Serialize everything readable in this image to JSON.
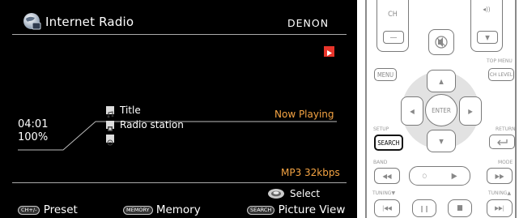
{
  "screen": {
    "title": "Internet Radio",
    "brand": "DENON",
    "status": "Now Playing",
    "time": "04:01",
    "buffer": "100%",
    "meta": [
      {
        "icon": "music-note-icon",
        "text": "Title"
      },
      {
        "icon": "radio-station-icon",
        "text": "Radio station"
      },
      {
        "icon": "album-icon",
        "text": ""
      }
    ],
    "format": "MP3 32kbps",
    "select_label": "Select",
    "footer": [
      {
        "key": "CH+/-",
        "label": "Preset"
      },
      {
        "key": "MEMORY",
        "label": "Memory"
      },
      {
        "key": "SEARCH",
        "label": "Picture View"
      }
    ],
    "colors": {
      "background": "#000000",
      "accent": "#f5a443",
      "play": "#e8352b"
    }
  },
  "remote": {
    "ch": "CH",
    "menu": "MENU",
    "enter": "ENTER",
    "top_menu": "TOP MENU",
    "ch_level": "CH LEVEL",
    "setup": "SETUP",
    "search": "SEARCH",
    "return": "RETURN",
    "band": "BAND",
    "mode": "MODE",
    "tuning_down": "TUNING▼",
    "tuning_up": "TUNING▲"
  }
}
